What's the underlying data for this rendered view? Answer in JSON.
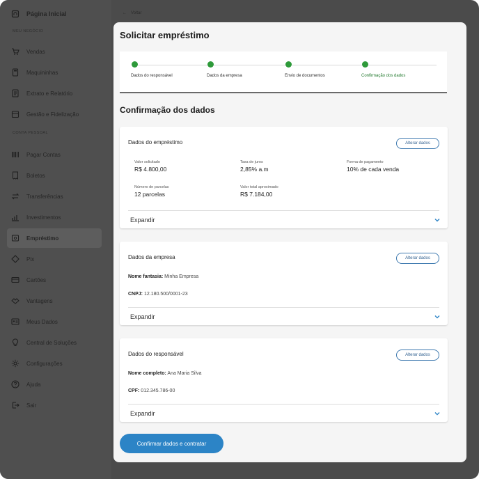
{
  "sidebar": {
    "home": "Página Inicial",
    "section_business": "MEU NEGÓCIO",
    "business_items": [
      "Vendas",
      "Maquininhas",
      "Extrato e Relatório",
      "Gestão e Fidelização"
    ],
    "section_account": "CONTA PESSOAL",
    "account_items": [
      "Pagar Contas",
      "Boletos",
      "Transferências",
      "Investimentos",
      "Empréstimo",
      "Pix",
      "Cartões",
      "Vantagens",
      "Meus Dados",
      "Central de Soluções",
      "Configurações",
      "Ajuda",
      "Sair"
    ]
  },
  "back_label": "Voltar",
  "page_title": "Solicitar empréstimo",
  "steps": [
    {
      "label": "Dados do responsável"
    },
    {
      "label": "Dados da empresa"
    },
    {
      "label": "Envio de documentos"
    },
    {
      "label": "Confirmação dos dados"
    }
  ],
  "section_title": "Confirmação dos dados",
  "loan_card": {
    "title": "Dados do empréstimo",
    "edit_label": "Alterar dados",
    "fields": [
      {
        "label": "Valor solicitado",
        "value": "R$ 4.800,00"
      },
      {
        "label": "Taxa de juros",
        "value": "2,85% a.m"
      },
      {
        "label": "Forma de pagamento",
        "value": "10% de cada venda"
      },
      {
        "label": "Número de parcelas",
        "value": "12 parcelas"
      },
      {
        "label": "Valor total aproximado",
        "value": "R$ 7.184,00"
      }
    ],
    "expand_label": "Expandir"
  },
  "company_card": {
    "title": "Dados da empresa",
    "edit_label": "Alterar dados",
    "rows": [
      {
        "key": "Nome fantasia:",
        "value": "Minha Empresa"
      },
      {
        "key": "CNPJ:",
        "value": "12.180.500/0001-23"
      }
    ],
    "expand_label": "Expandir"
  },
  "responsible_card": {
    "title": "Dados do responsável",
    "edit_label": "Alterar dados",
    "rows": [
      {
        "key": "Nome completo:",
        "value": "Ana Maria Silva"
      },
      {
        "key": "CPF:",
        "value": "012.345.786-00"
      }
    ],
    "expand_label": "Expandir"
  },
  "confirm_label": "Confirmar dados e contratar",
  "colors": {
    "primary": "#2c84c6",
    "step_done": "#2e9a3a",
    "overlay": "#4f4f4f"
  }
}
